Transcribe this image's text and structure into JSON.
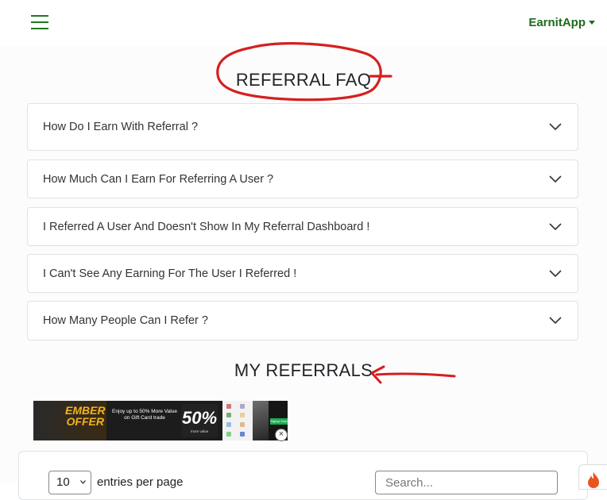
{
  "navbar": {
    "brand": "EarnitApp"
  },
  "faq": {
    "title": "REFERRAL FAQ",
    "items": [
      {
        "question": "How Do I Earn With Referral ?"
      },
      {
        "question": "How Much Can I Earn For Referring A User ?"
      },
      {
        "question": "I Referred A User And Doesn't Show In My Referral Dashboard !"
      },
      {
        "question": "I Can't See Any Earning For The User I Referred !"
      },
      {
        "question": "How Many People Can I Refer ?"
      }
    ]
  },
  "referrals": {
    "title": "MY REFERRALS"
  },
  "ad": {
    "brand_line1": "EMBER",
    "brand_line2": "OFFER",
    "tagline": "Enjoy up to 50% More Value on Gift Card trade",
    "percent": "50%",
    "percent_sub": "more value",
    "button": "Signup Now"
  },
  "table": {
    "length_value": "10",
    "length_label": "entries per page",
    "search_placeholder": "Search..."
  },
  "colors": {
    "brand_green": "#1e6b1e",
    "annotation_red": "#d61f1f"
  }
}
